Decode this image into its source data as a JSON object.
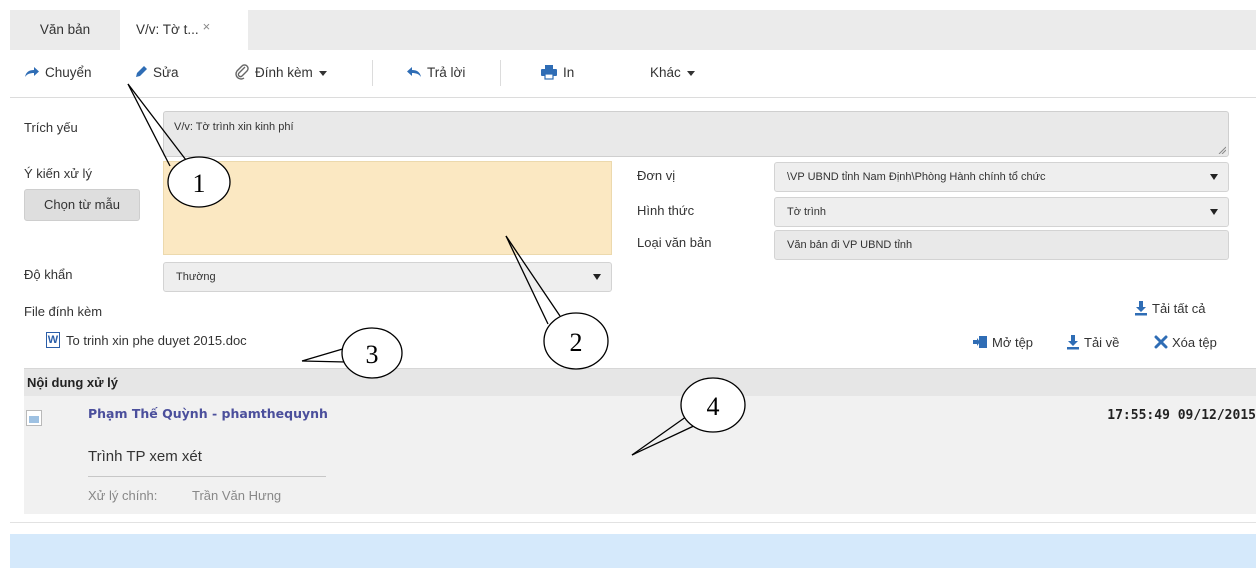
{
  "tabs": [
    {
      "label": "Văn bản"
    },
    {
      "label": "V/v: Tờ t...",
      "close": "×"
    }
  ],
  "toolbar": {
    "forward": "Chuyển",
    "edit": "Sửa",
    "attach": "Đính kèm",
    "reply": "Trả lời",
    "print": "In",
    "other": "Khác"
  },
  "form": {
    "summary_label": "Trích yếu",
    "summary_value": "V/v: Tờ trình xin kinh phí",
    "opinion_label": "Ý kiến xử lý",
    "template_button": "Chọn từ mẫu",
    "urgency_label": "Độ khẩn",
    "urgency_value": "Thường",
    "unit_label": "Đơn vị",
    "unit_value": "\\VP UBND tỉnh Nam Định\\Phòng Hành chính tổ chức",
    "form_label": "Hình thức",
    "form_value": "Tờ trình",
    "doctype_label": "Loại văn bản",
    "doctype_value": "Văn bản đi VP UBND tỉnh"
  },
  "attachments": {
    "label": "File đính kèm",
    "download_all": "Tải tất cả",
    "file_name": "To trinh xin phe duyet 2015.doc",
    "open": "Mở tệp",
    "download": "Tải về",
    "delete": "Xóa tệp"
  },
  "processing": {
    "title": "Nội dung xử lý",
    "author": "Phạm Thế Quỳnh - phamthequynh",
    "time": "17:55:49 09/12/2015",
    "content": "Trình TP xem xét",
    "meta_key": "Xử lý chính:",
    "meta_value": "Trần Văn Hưng"
  },
  "callouts": [
    "1",
    "2",
    "3",
    "4"
  ],
  "colors": {
    "tab_bar": "#ebebeb",
    "opinion_bg": "#fbe8c2",
    "author_link": "#4b4f9c",
    "icon_blue": "#2f6db5",
    "footer_bar": "#d5e9fb"
  }
}
